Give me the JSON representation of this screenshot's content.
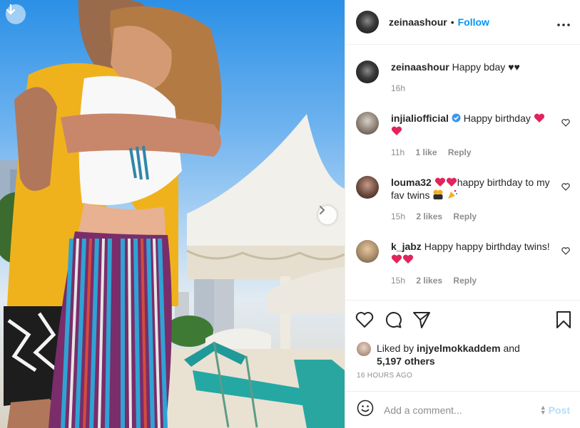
{
  "post": {
    "author": "zeinaashour",
    "follow_label": "Follow",
    "separator": "•",
    "more_label": "•••"
  },
  "caption": {
    "user": "zeinaashour",
    "text": "Happy bday ♥♥",
    "time": "16h"
  },
  "comments": [
    {
      "user": "injialiofficial",
      "verified": true,
      "text": "Happy birthday",
      "time": "11h",
      "likes": "1 like",
      "reply": "Reply"
    },
    {
      "user": "louma32",
      "text_after": "happy birthday to my fav twins",
      "time": "15h",
      "likes": "2 likes",
      "reply": "Reply"
    },
    {
      "user": "k_jabz",
      "text": "Happy happy birthday twins!",
      "time": "15h",
      "likes": "2 likes",
      "reply": "Reply"
    }
  ],
  "likes": {
    "prefix": "Liked by",
    "user": "injyelmokkaddem",
    "conjunction": "and",
    "others": "5,197 others"
  },
  "timestamp": "16 HOURS AGO",
  "add_comment": {
    "placeholder": "Add a comment...",
    "post_label": "Post"
  },
  "colors": {
    "accent": "#0095f6",
    "post_disabled": "#b2dffc",
    "meta_text": "#8e8e8e",
    "heart_red": "#e0245e"
  }
}
